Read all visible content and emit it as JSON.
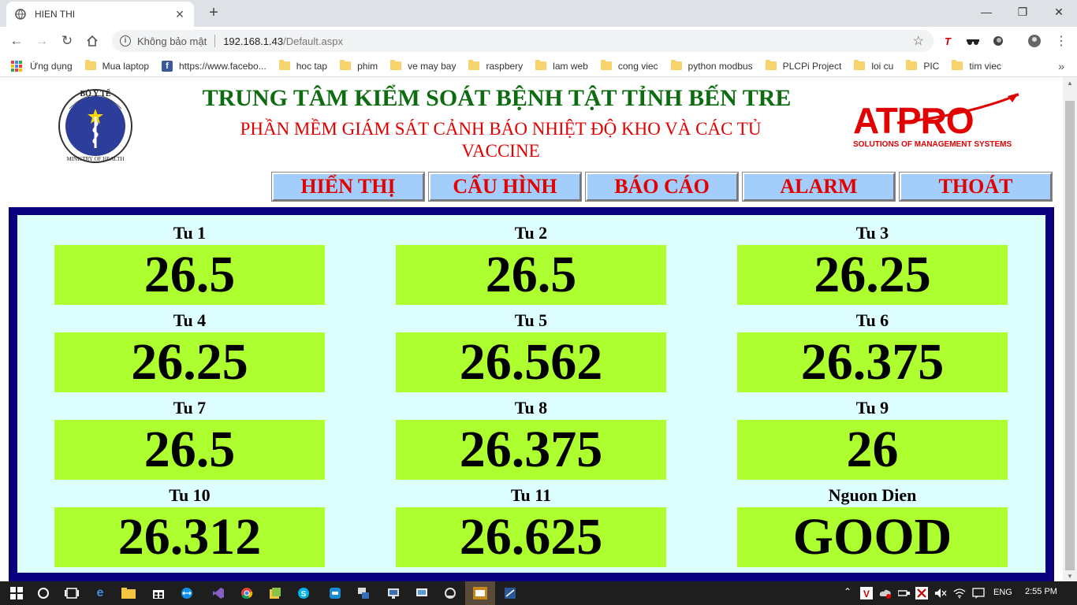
{
  "browser": {
    "tab_title": "HIEN THI",
    "security_label": "Không bảo mật",
    "url_host": "192.168.1.43",
    "url_path": "/Default.aspx",
    "bookmarks": [
      {
        "label": "Ứng dụng",
        "icon": "apps-icon"
      },
      {
        "label": "Mua laptop",
        "icon": "folder-icon"
      },
      {
        "label": "https://www.facebo...",
        "icon": "facebook-icon"
      },
      {
        "label": "hoc tap",
        "icon": "folder-icon"
      },
      {
        "label": "phim",
        "icon": "folder-icon"
      },
      {
        "label": "ve may bay",
        "icon": "folder-icon"
      },
      {
        "label": "raspbery",
        "icon": "folder-icon"
      },
      {
        "label": "lam web",
        "icon": "folder-icon"
      },
      {
        "label": "cong viec",
        "icon": "folder-icon"
      },
      {
        "label": "python modbus",
        "icon": "folder-icon"
      },
      {
        "label": "PLCPi Project",
        "icon": "folder-icon"
      },
      {
        "label": "loi cu",
        "icon": "folder-icon"
      },
      {
        "label": "PIC",
        "icon": "folder-icon"
      },
      {
        "label": "tim viec",
        "icon": "folder-icon"
      }
    ]
  },
  "header": {
    "logo_top": "BỘ Y TẾ",
    "logo_bottom": "MINISTRY OF HEALTH",
    "title": "TRUNG TÂM KIỂM SOÁT BỆNH TẬT TỈNH BẾN TRE",
    "subtitle": "PHẦN MỀM GIÁM SÁT CẢNH BÁO NHIỆT ĐỘ KHO VÀ CÁC TỦ VACCINE",
    "brand": "ATPRO",
    "brand_tagline": "SOLUTIONS OF MANAGEMENT SYSTEMS"
  },
  "nav": [
    {
      "label": "HIỂN THỊ"
    },
    {
      "label": "CẤU HÌNH"
    },
    {
      "label": "BÁO CÁO"
    },
    {
      "label": "ALARM"
    },
    {
      "label": "THOÁT"
    }
  ],
  "cells": [
    {
      "label": "Tu 1",
      "value": "26.5"
    },
    {
      "label": "Tu 2",
      "value": "26.5"
    },
    {
      "label": "Tu 3",
      "value": "26.25"
    },
    {
      "label": "Tu 4",
      "value": "26.25"
    },
    {
      "label": "Tu 5",
      "value": "26.562"
    },
    {
      "label": "Tu 6",
      "value": "26.375"
    },
    {
      "label": "Tu 7",
      "value": "26.5"
    },
    {
      "label": "Tu 8",
      "value": "26.375"
    },
    {
      "label": "Tu 9",
      "value": "26"
    },
    {
      "label": "Tu 10",
      "value": "26.312"
    },
    {
      "label": "Tu 11",
      "value": "26.625"
    },
    {
      "label": "Nguon Dien",
      "value": "GOOD"
    }
  ],
  "colors": {
    "title_green": "#0d6b10",
    "alert_red": "#e20000",
    "nav_blue": "#a3cdfa",
    "panel_navy": "#0a007d",
    "panel_bg": "#ddffff",
    "value_bg": "#adff2f"
  },
  "taskbar": {
    "language": "ENG",
    "time": "2:55 PM"
  }
}
